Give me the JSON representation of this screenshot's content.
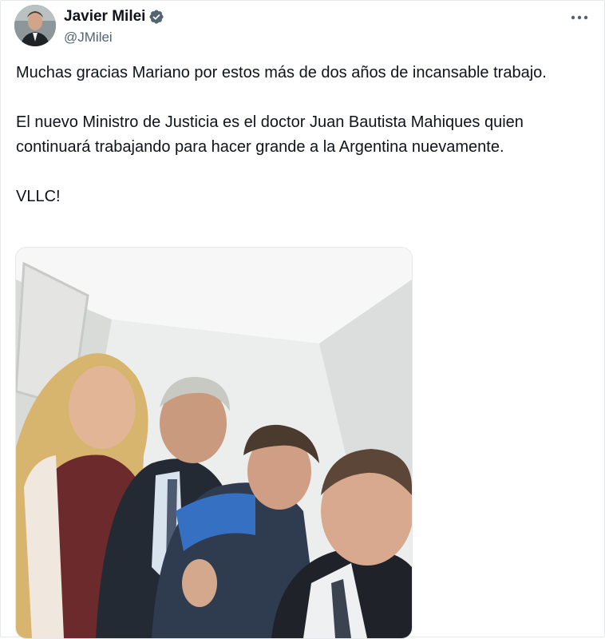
{
  "tweet": {
    "author": {
      "display_name": "Javier Milei",
      "handle": "@JMilei",
      "verified": true
    },
    "more_icon": "more-horizontal-icon",
    "paragraphs": [
      "Muchas gracias Mariano por estos más de dos años de incansable trabajo.",
      "El nuevo Ministro de Justicia es el doctor Juan Bautista Mahiques quien continuará trabajando para hacer grande a la Argentina nuevamente.",
      "VLLC!"
    ],
    "media": {
      "type": "photo",
      "description_icon": "selfie-photo"
    }
  },
  "colors": {
    "text": "#0f1419",
    "secondary": "#536471",
    "verified": "#1d9bf0"
  }
}
